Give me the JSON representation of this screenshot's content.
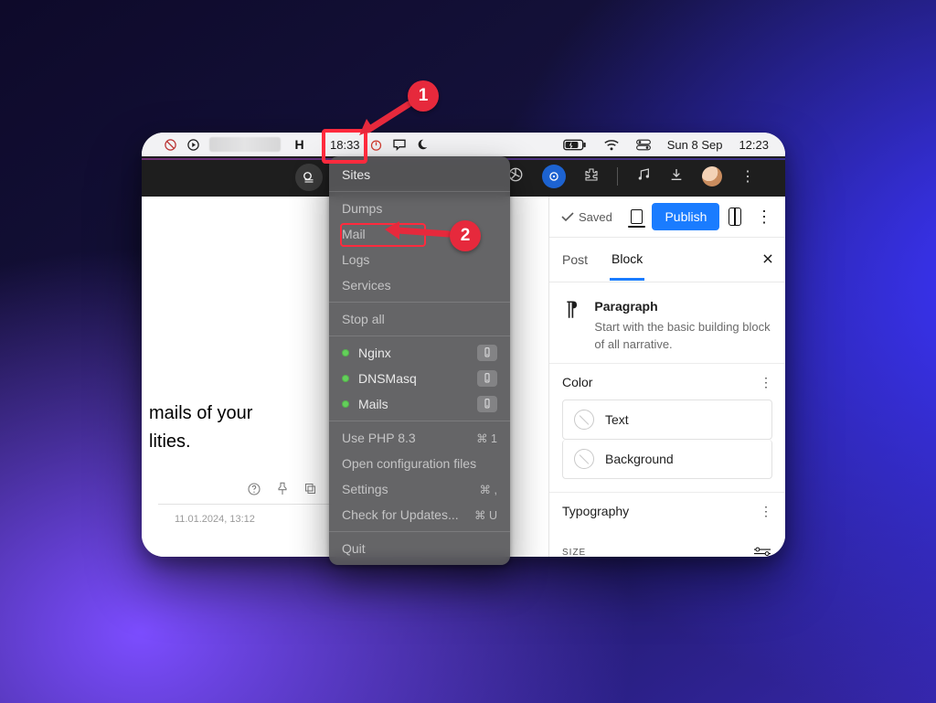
{
  "annotations": {
    "1": "1",
    "2": "2"
  },
  "menubar": {
    "herd_icon_label": "H",
    "time_left": "18:33",
    "date": "Sun 8 Sep",
    "time_right": "12:23"
  },
  "dropdown": {
    "sections": {
      "sites": "Sites",
      "dumps": "Dumps",
      "mail": "Mail",
      "logs": "Logs",
      "services": "Services",
      "stop_all": "Stop all"
    },
    "status": [
      {
        "name": "Nginx"
      },
      {
        "name": "DNSMasq"
      },
      {
        "name": "Mails"
      }
    ],
    "config": {
      "use_php": "Use PHP 8.3",
      "use_php_shortcut": "⌘ 1",
      "open_config": "Open configuration files",
      "settings": "Settings",
      "settings_shortcut": "⌘ ,",
      "updates": "Check for Updates...",
      "updates_shortcut": "⌘ U",
      "quit": "Quit"
    }
  },
  "left_fragment": {
    "line1": "mails of your",
    "line2": "lities.",
    "timestamp": "11.01.2024, 13:12"
  },
  "wordpress": {
    "saved_label": "Saved",
    "publish_label": "Publish",
    "tabs": {
      "post": "Post",
      "block": "Block"
    },
    "block": {
      "title": "Paragraph",
      "desc": "Start with the basic building block of all narrative."
    },
    "color": {
      "header": "Color",
      "text": "Text",
      "background": "Background"
    },
    "typography": {
      "header": "Typography",
      "size_label": "SIZE"
    }
  }
}
